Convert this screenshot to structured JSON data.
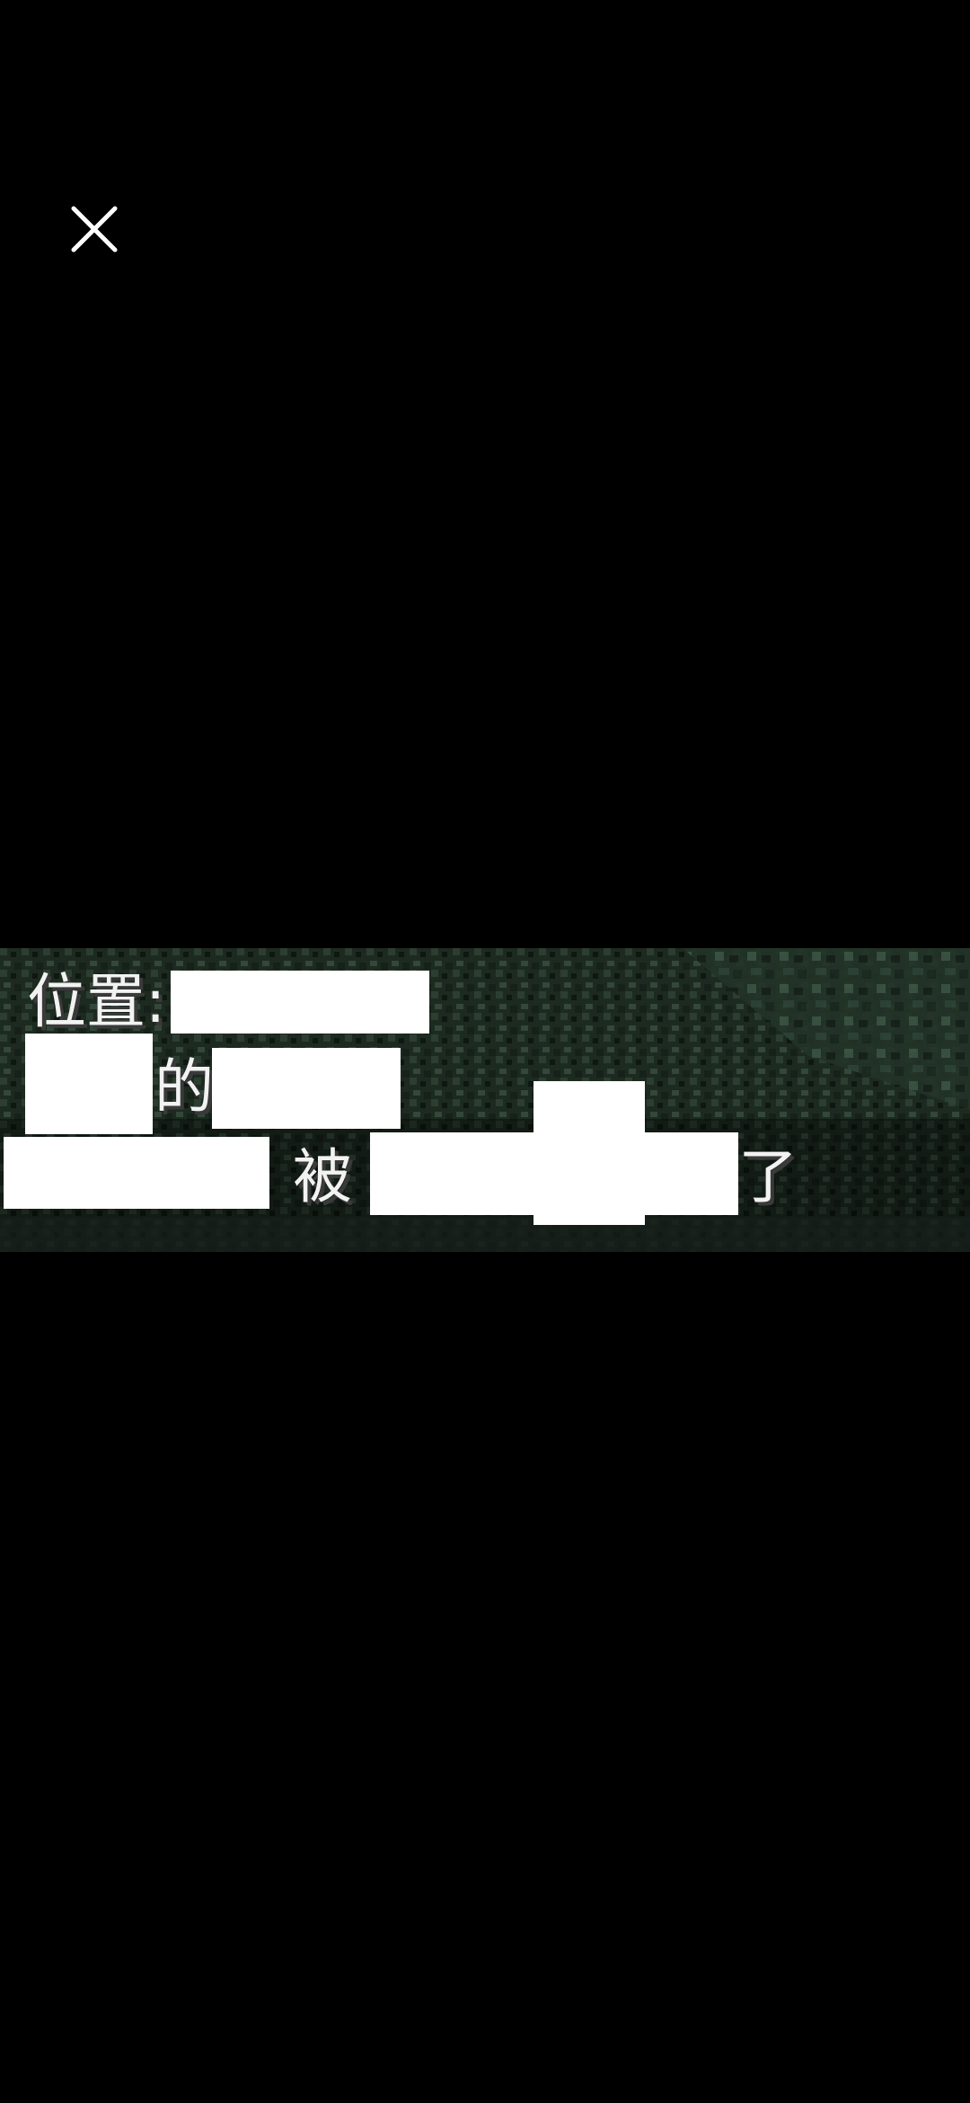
{
  "viewer": {
    "close_icon": "close-icon",
    "caption": {
      "line1_prefix": "位置:",
      "line2_mid": "的",
      "line3_mid": "被",
      "line3_end": "了"
    }
  }
}
